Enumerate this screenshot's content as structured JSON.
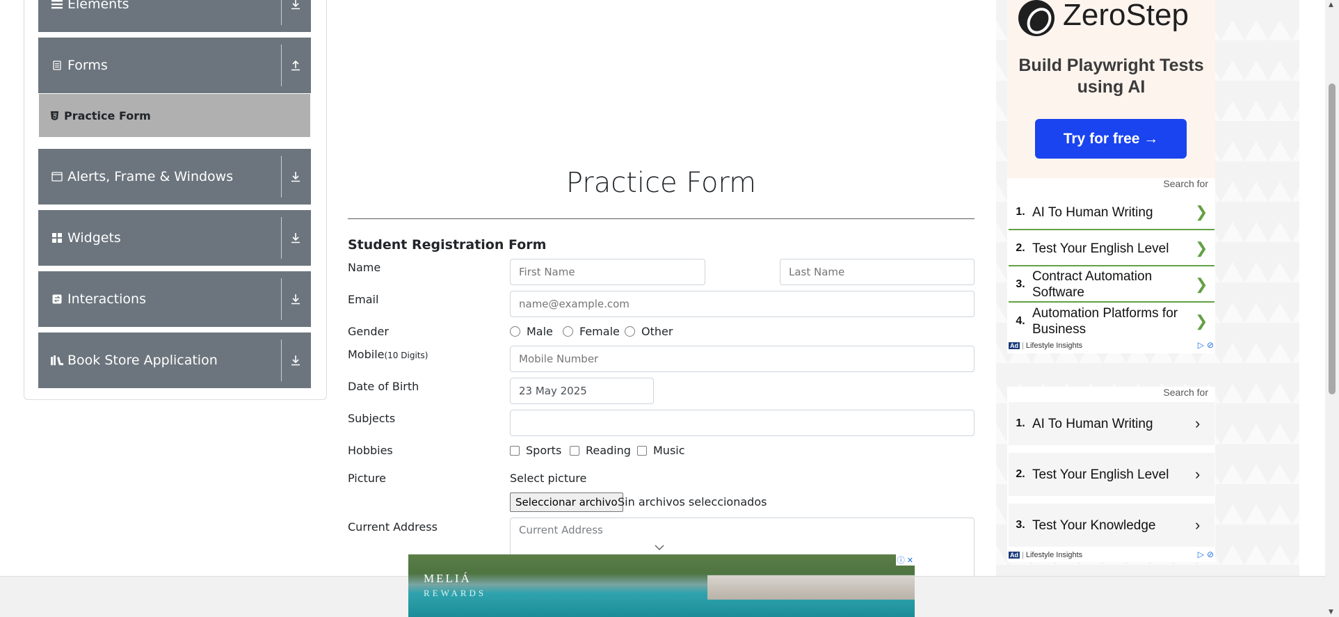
{
  "sidebar": {
    "groups": [
      {
        "label": "Elements",
        "icon": "hamburger-icon",
        "arrow": "download-arrow-icon"
      },
      {
        "label": "Forms",
        "icon": "document-icon",
        "arrow": "upload-arrow-icon"
      },
      {
        "label": "Alerts, Frame & Windows",
        "icon": "window-icon",
        "arrow": "download-arrow-icon"
      },
      {
        "label": "Widgets",
        "icon": "grid-icon",
        "arrow": "download-arrow-icon"
      },
      {
        "label": "Interactions",
        "icon": "interaction-icon",
        "arrow": "download-arrow-icon"
      },
      {
        "label": "Book Store Application",
        "icon": "books-icon",
        "arrow": "download-arrow-icon"
      }
    ],
    "active_item": {
      "label": "Practice Form",
      "icon": "html5-icon"
    }
  },
  "form": {
    "title": "Practice Form",
    "subtitle": "Student Registration Form",
    "labels": {
      "name": "Name",
      "email": "Email",
      "gender": "Gender",
      "mobile": "Mobile",
      "mobile_hint": "(10 Digits)",
      "dob": "Date of Birth",
      "subjects": "Subjects",
      "hobbies": "Hobbies",
      "picture": "Picture",
      "address": "Current Address"
    },
    "placeholders": {
      "first_name": "First Name",
      "last_name": "Last Name",
      "email": "name@example.com",
      "mobile": "Mobile Number",
      "address": "Current Address"
    },
    "dob_value": "23 May 2025",
    "subjects_value": "",
    "genders": [
      "Male",
      "Female",
      "Other"
    ],
    "hobbies": [
      "Sports",
      "Reading",
      "Music"
    ],
    "select_picture": "Select picture",
    "file_button": "Seleccionar archivo",
    "file_status": "Sin archivos seleccionados"
  },
  "ads": {
    "zerostep": {
      "brand": "ZeroStep",
      "tagline": "Build Playwright Tests using AI",
      "cta": "Try for free →",
      "bg_color": "#fdf4ee",
      "cta_color": "#1a44f0"
    },
    "search_for": "Search for",
    "panel1": [
      {
        "num": "1.",
        "text": "AI To Human Writing"
      },
      {
        "num": "2.",
        "text": "Test Your English Level"
      },
      {
        "num": "3.",
        "text": "Contract Automation Software"
      },
      {
        "num": "4.",
        "text": "Automation Platforms for Business"
      }
    ],
    "panel2": [
      {
        "num": "1.",
        "text": "AI To Human Writing"
      },
      {
        "num": "2.",
        "text": "Test Your English Level"
      },
      {
        "num": "3.",
        "text": "Test Your Knowledge"
      }
    ],
    "ad_badge": "Ad",
    "ad_source": "Lifestyle Insights",
    "accent_green": "#62a044"
  },
  "banner": {
    "brand": "MELIÁ",
    "brand_sub": "REWARDS"
  },
  "colors": {
    "sidebar_group": "#6c757d",
    "sidebar_active": "#b0b0b0"
  }
}
